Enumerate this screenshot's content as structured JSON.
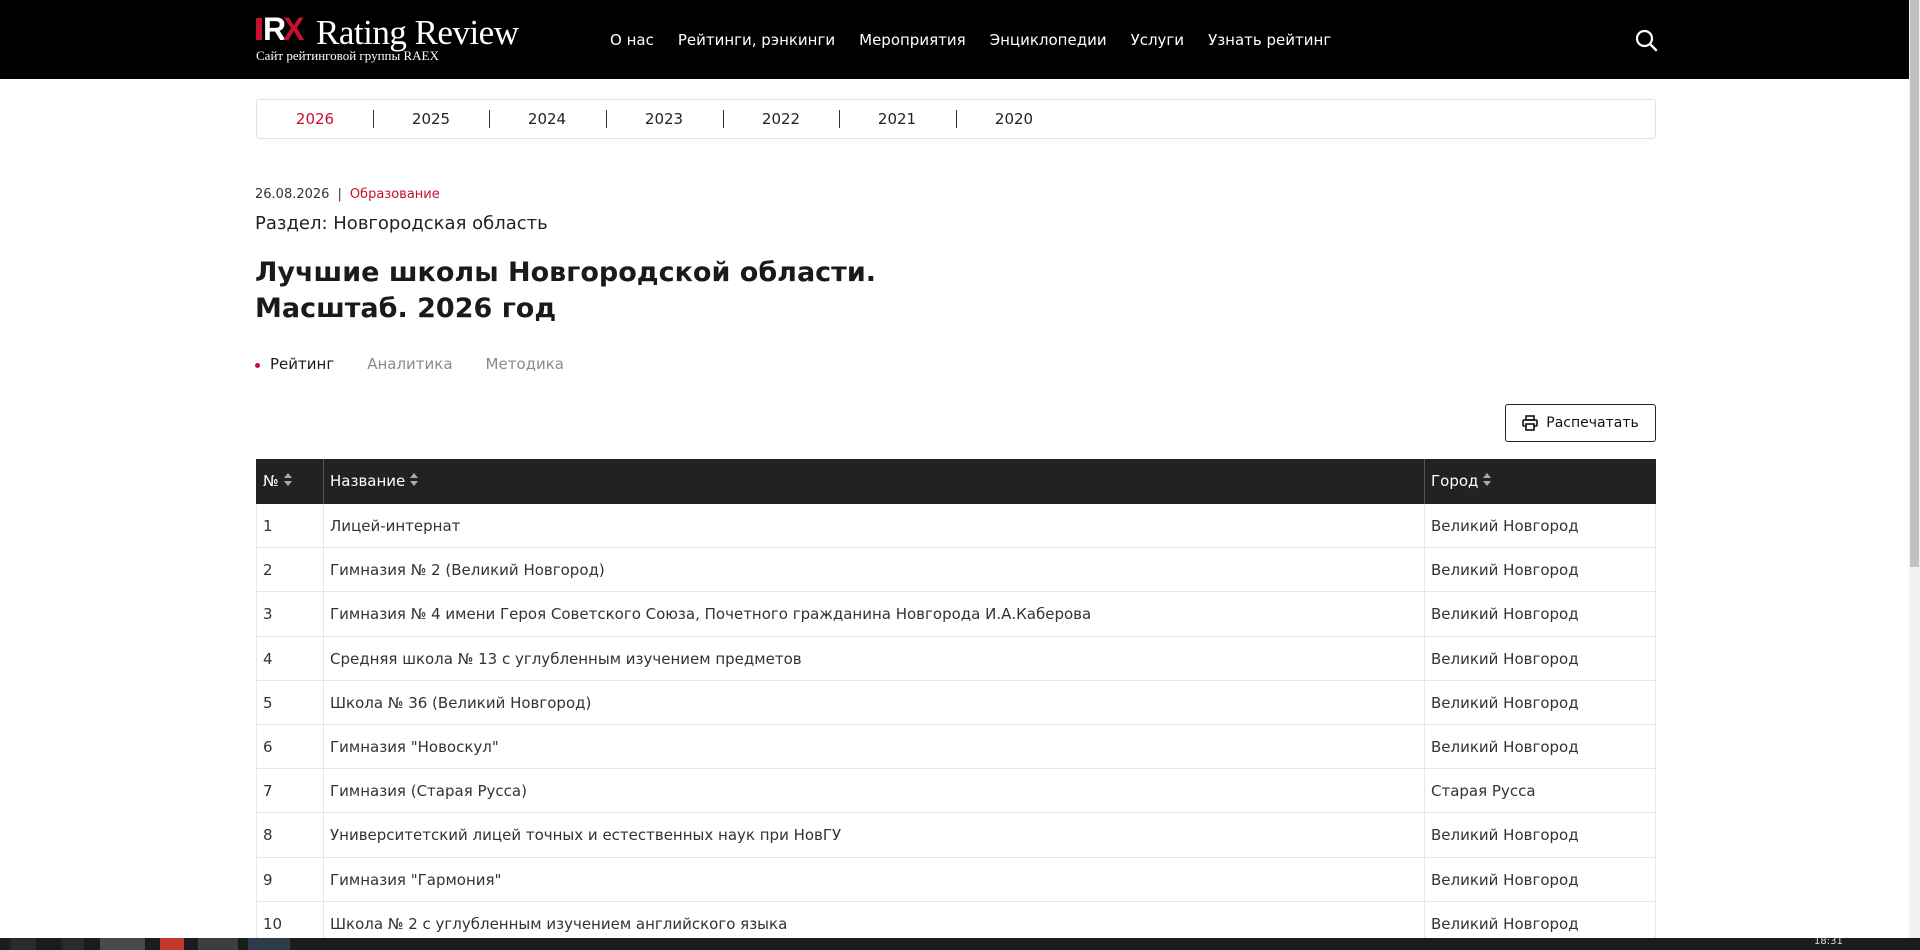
{
  "header": {
    "logo_mark_a": "R",
    "logo_mark_b": "X",
    "logo_title": "Rating Review",
    "logo_subtitle": "Сайт рейтинговой группы RAEX",
    "nav": [
      "О нас",
      "Рейтинги, рэнкинги",
      "Мероприятия",
      "Энциклопедии",
      "Услуги",
      "Узнать рейтинг"
    ],
    "search_icon": "search-icon"
  },
  "years": {
    "items": [
      "2026",
      "2025",
      "2024",
      "2023",
      "2022",
      "2021",
      "2020"
    ],
    "active": "2026"
  },
  "meta": {
    "date": "26.08.2026",
    "separator": "|",
    "category": "Образование"
  },
  "section": "Раздел: Новгородская область",
  "title": "Лучшие школы Новгородской области. Масштаб. 2026 год",
  "subtabs": {
    "items": [
      "Рейтинг",
      "Аналитика",
      "Методика"
    ],
    "active": "Рейтинг"
  },
  "print_button": {
    "label": "Распечатать",
    "icon": "printer-icon"
  },
  "table": {
    "columns": [
      "№",
      "Название",
      "Город"
    ],
    "rows": [
      [
        "1",
        "Лицей-интернат",
        "Великий Новгород"
      ],
      [
        "2",
        "Гимназия № 2 (Великий Новгород)",
        "Великий Новгород"
      ],
      [
        "3",
        "Гимназия № 4 имени Героя Советского Союза, Почетного гражданина Новгорода И.А.Каберова",
        "Великий Новгород"
      ],
      [
        "4",
        "Средняя школа № 13 с углубленным изучением предметов",
        "Великий Новгород"
      ],
      [
        "5",
        "Школа № 36 (Великий Новгород)",
        "Великий Новгород"
      ],
      [
        "6",
        "Гимназия \"Новоскул\"",
        "Великий Новгород"
      ],
      [
        "7",
        "Гимназия (Старая Русса)",
        "Старая Русса"
      ],
      [
        "8",
        "Университетский лицей точных и естественных наук при НовГУ",
        "Великий Новгород"
      ],
      [
        "9",
        "Гимназия \"Гармония\"",
        "Великий Новгород"
      ],
      [
        "10",
        "Школа № 2 с углубленным изучением английского языка",
        "Великий Новгород"
      ]
    ]
  },
  "taskbar": {
    "clock": "18:31"
  },
  "colors": {
    "accent": "#c8102e",
    "header_bg": "#000000",
    "table_header_bg": "#222222"
  }
}
